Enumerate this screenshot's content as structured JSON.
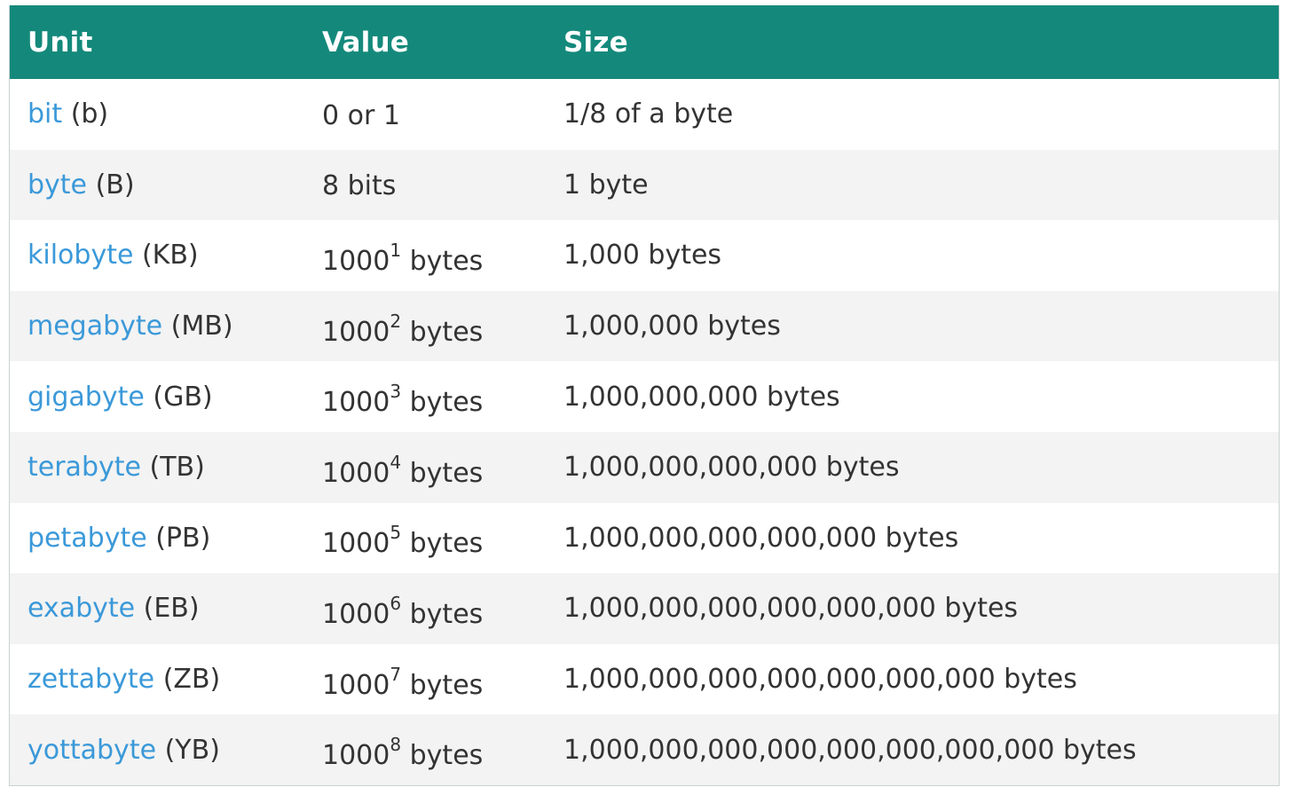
{
  "table": {
    "headers": {
      "unit": "Unit",
      "value": "Value",
      "size": "Size"
    },
    "rows": [
      {
        "unit_name": "bit",
        "unit_abbr": "(b)",
        "value_base": "0 or 1",
        "value_exp": "",
        "value_suffix": "",
        "size": "1/8 of a byte"
      },
      {
        "unit_name": "byte",
        "unit_abbr": "(B)",
        "value_base": "8 bits",
        "value_exp": "",
        "value_suffix": "",
        "size": "1 byte"
      },
      {
        "unit_name": "kilobyte",
        "unit_abbr": "(KB)",
        "value_base": "1000",
        "value_exp": "1",
        "value_suffix": " bytes",
        "size": "1,000 bytes"
      },
      {
        "unit_name": "megabyte",
        "unit_abbr": "(MB)",
        "value_base": "1000",
        "value_exp": "2",
        "value_suffix": " bytes",
        "size": "1,000,000 bytes"
      },
      {
        "unit_name": "gigabyte",
        "unit_abbr": "(GB)",
        "value_base": "1000",
        "value_exp": "3",
        "value_suffix": " bytes",
        "size": "1,000,000,000 bytes"
      },
      {
        "unit_name": "terabyte",
        "unit_abbr": "(TB)",
        "value_base": "1000",
        "value_exp": "4",
        "value_suffix": " bytes",
        "size": "1,000,000,000,000 bytes"
      },
      {
        "unit_name": "petabyte",
        "unit_abbr": "(PB)",
        "value_base": "1000",
        "value_exp": "5",
        "value_suffix": " bytes",
        "size": "1,000,000,000,000,000 bytes"
      },
      {
        "unit_name": "exabyte",
        "unit_abbr": "(EB)",
        "value_base": "1000",
        "value_exp": "6",
        "value_suffix": " bytes",
        "size": "1,000,000,000,000,000,000 bytes"
      },
      {
        "unit_name": "zettabyte",
        "unit_abbr": "(ZB)",
        "value_base": "1000",
        "value_exp": "7",
        "value_suffix": " bytes",
        "size": "1,000,000,000,000,000,000,000 bytes"
      },
      {
        "unit_name": "yottabyte",
        "unit_abbr": "(YB)",
        "value_base": "1000",
        "value_exp": "8",
        "value_suffix": " bytes",
        "size": "1,000,000,000,000,000,000,000,000 bytes"
      }
    ]
  },
  "colors": {
    "header_bg": "#14897b",
    "header_text": "#ffffff",
    "link": "#3b99d9",
    "text": "#333333",
    "row_alt": "#f3f3f3"
  }
}
